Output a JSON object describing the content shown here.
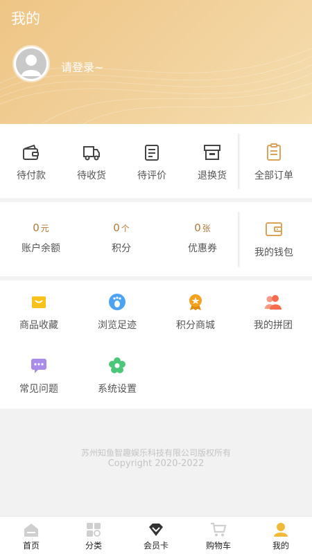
{
  "header": {
    "title": "我的",
    "login_text": "请登录~"
  },
  "orders": {
    "items": [
      {
        "label": "待付款",
        "icon": "wallet-icon"
      },
      {
        "label": "待收货",
        "icon": "truck-icon"
      },
      {
        "label": "待评价",
        "icon": "clipboard-icon"
      },
      {
        "label": "退换货",
        "icon": "box-icon"
      }
    ],
    "all": {
      "label": "全部订单",
      "icon": "order-list-icon"
    }
  },
  "wallet": {
    "items": [
      {
        "value": "0",
        "unit": "元",
        "label": "账户余额"
      },
      {
        "value": "0",
        "unit": "个",
        "label": "积分"
      },
      {
        "value": "0",
        "unit": "张",
        "label": "优惠券"
      }
    ],
    "my_wallet": {
      "label": "我的钱包",
      "icon": "purse-icon"
    }
  },
  "services": {
    "items": [
      {
        "label": "商品收藏",
        "icon": "favorites-icon",
        "color": "#f7c21b"
      },
      {
        "label": "浏览足迹",
        "icon": "footprint-icon",
        "color": "#4da3f2"
      },
      {
        "label": "积分商城",
        "icon": "medal-icon",
        "color": "#f4a11d"
      },
      {
        "label": "我的拼团",
        "icon": "group-icon",
        "color": "#f56d4d"
      },
      {
        "label": "常见问题",
        "icon": "chat-icon",
        "color": "#a98be8"
      },
      {
        "label": "系统设置",
        "icon": "settings-flower-icon",
        "color": "#4cc77a"
      }
    ]
  },
  "footer": {
    "line1": "苏州知鱼智趣娱乐科技有限公司版权所有",
    "line2": "Copyright 2020-2022"
  },
  "tabbar": {
    "items": [
      {
        "label": "首页",
        "icon": "home-icon"
      },
      {
        "label": "分类",
        "icon": "category-icon"
      },
      {
        "label": "会员卡",
        "icon": "diamond-icon"
      },
      {
        "label": "购物车",
        "icon": "cart-icon"
      },
      {
        "label": "我的",
        "icon": "profile-icon"
      }
    ],
    "active_color": "#f0b93a"
  }
}
